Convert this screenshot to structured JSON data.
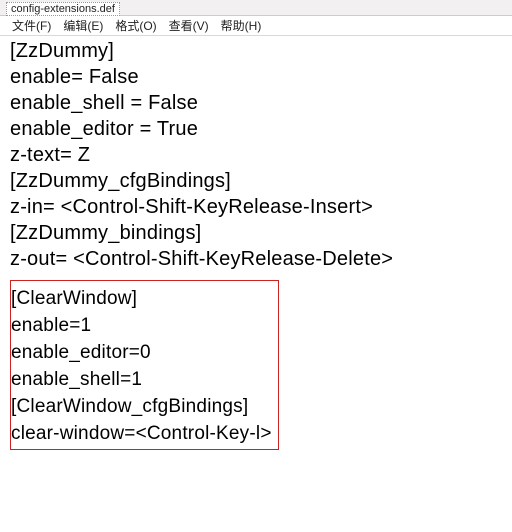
{
  "titlebar": {
    "filename": "config-extensions.def"
  },
  "menu": {
    "file": "文件(F)",
    "edit": "编辑(E)",
    "format": "格式(O)",
    "view": "查看(V)",
    "help": "帮助(H)"
  },
  "section1": {
    "header": "[ZzDummy]",
    "l1": "enable= False",
    "l2": "enable_shell = False",
    "l3": "enable_editor = True",
    "l4": "z-text= Z",
    "sub1": "[ZzDummy_cfgBindings]",
    "l5": "z-in= <Control-Shift-KeyRelease-Insert>",
    "sub2": "[ZzDummy_bindings]",
    "l6": "z-out= <Control-Shift-KeyRelease-Delete>"
  },
  "section2": {
    "header": "[ClearWindow]",
    "l1": "enable=1",
    "l2": "enable_editor=0",
    "l3": "enable_shell=1",
    "sub1": "[ClearWindow_cfgBindings]",
    "l4": "clear-window=<Control-Key-l>"
  }
}
